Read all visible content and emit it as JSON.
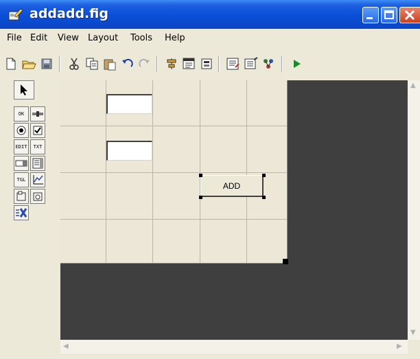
{
  "window": {
    "title": "addadd.fig",
    "controls": [
      "minimize",
      "maximize",
      "close"
    ]
  },
  "menu": [
    "File",
    "Edit",
    "View",
    "Layout",
    "Tools",
    "Help"
  ],
  "toolbar": {
    "icons": [
      "new-file-icon",
      "open-folder-icon",
      "save-icon",
      "cut-icon",
      "copy-icon",
      "paste-icon",
      "undo-icon",
      "redo-icon",
      "align-icon",
      "menu-editor-icon",
      "tab-order-icon",
      "m-file-editor-icon",
      "property-inspector-icon",
      "object-browser-icon",
      "run-icon"
    ]
  },
  "palette": {
    "items": [
      {
        "name": "select-tool",
        "label": ""
      },
      {
        "name": "push-button-tool",
        "label": "OK"
      },
      {
        "name": "slider-tool",
        "label": ""
      },
      {
        "name": "radio-button-tool",
        "label": ""
      },
      {
        "name": "checkbox-tool",
        "label": ""
      },
      {
        "name": "edit-text-tool",
        "label": "EDIT"
      },
      {
        "name": "static-text-tool",
        "label": "TXT"
      },
      {
        "name": "popup-menu-tool",
        "label": ""
      },
      {
        "name": "listbox-tool",
        "label": ""
      },
      {
        "name": "toggle-button-tool",
        "label": "TGL"
      },
      {
        "name": "axes-tool",
        "label": ""
      },
      {
        "name": "panel-tool",
        "label": ""
      },
      {
        "name": "button-group-tool",
        "label": ""
      },
      {
        "name": "activex-tool",
        "label": ""
      }
    ]
  },
  "canvas": {
    "push_button_label": "ADD",
    "edit_boxes": [
      "",
      ""
    ]
  },
  "colors": {
    "titlebar": "#0a4ed8",
    "chrome": "#ece9d8",
    "canvas": "#ede7d7",
    "layout_bg": "#3f3f3f"
  }
}
